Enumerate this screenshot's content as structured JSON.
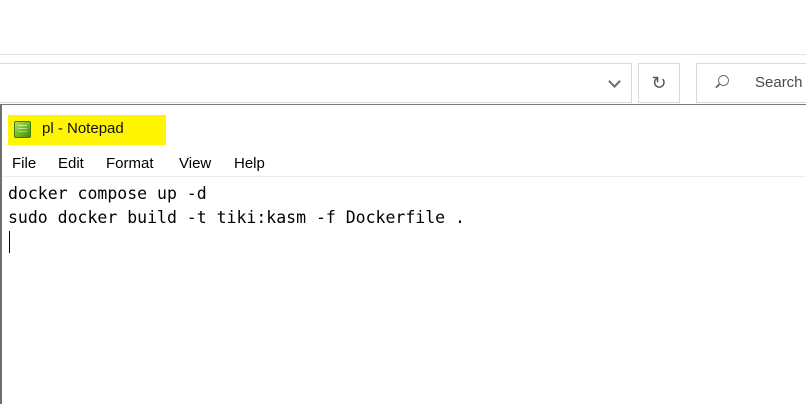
{
  "explorer": {
    "search_placeholder": "Search",
    "refresh_glyph": "↻"
  },
  "notepad": {
    "title": "pl - Notepad",
    "menu": [
      "File",
      "Edit",
      "Format",
      "View",
      "Help"
    ],
    "lines": [
      "docker compose up -d",
      "sudo docker build -t tiki:kasm -f Dockerfile ."
    ]
  },
  "colors": {
    "title_highlight": "#fff500"
  }
}
